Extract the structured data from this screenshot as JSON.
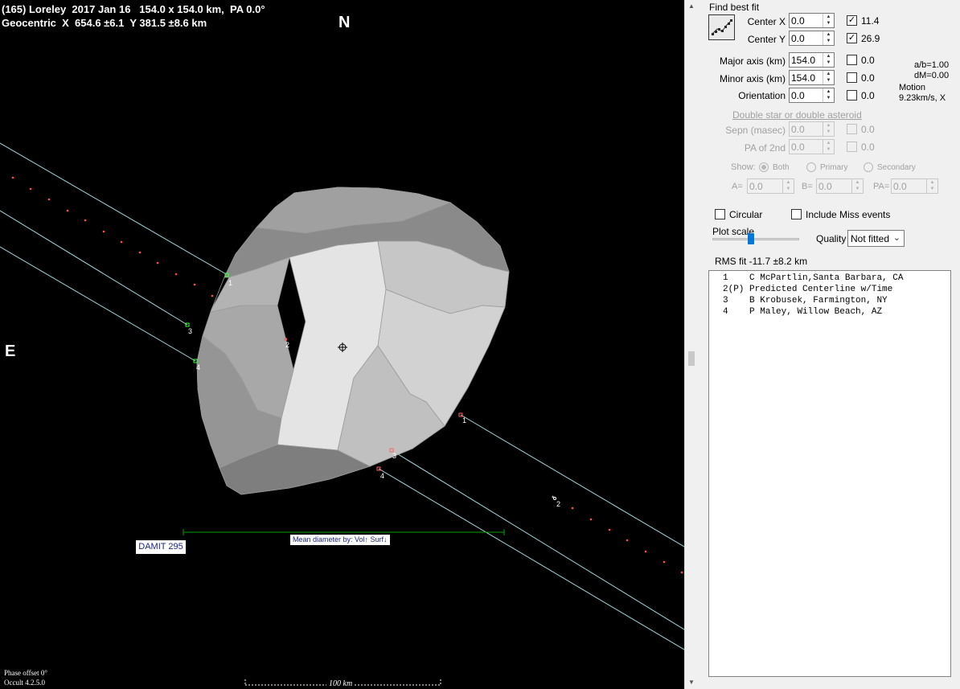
{
  "title": {
    "line1": "(165) Loreley  2017 Jan 16   154.0 x 154.0 km,  PA 0.0°",
    "line2": "Geocentric  X  654.6 ±6.1  Y 381.5 ±8.6 km"
  },
  "plot": {
    "north_label": "N",
    "east_label": "E",
    "damit_label": "DAMIT 295",
    "mean_diameter_label": "Mean diameter by:  Vol↑  Surf↓",
    "scale_bar_label": "100 km",
    "phase_offset": "Phase offset 0°",
    "version": "Occult 4.2.5.0",
    "chord_labels": [
      "1",
      "2",
      "3",
      "4",
      "1",
      "2",
      "3",
      "4",
      "2"
    ],
    "colors": {
      "background": "#000000",
      "chord": "#a8d8e0",
      "prediction_dots": "#ff5050",
      "scale_bar": "#00a000",
      "shape": "#b8b8b8"
    }
  },
  "panel": {
    "find_best_fit": "Find best fit",
    "center_x": {
      "label": "Center X",
      "value": "0.0",
      "checked": true,
      "fit": "11.4"
    },
    "center_y": {
      "label": "Center Y",
      "value": "0.0",
      "checked": true,
      "fit": "26.9"
    },
    "major_axis": {
      "label": "Major axis (km)",
      "value": "154.0",
      "checked": false,
      "fit": "0.0"
    },
    "minor_axis": {
      "label": "Minor axis (km)",
      "value": "154.0",
      "checked": false,
      "fit": "0.0"
    },
    "orientation": {
      "label": "Orientation",
      "value": "0.0",
      "checked": false,
      "fit": "0.0"
    },
    "ratio_info": "a/b=1.00",
    "dm_info": "dM=0.00",
    "motion_label": "Motion",
    "motion_value": "9.23km/s, X",
    "double_star_label": "Double star  or  double asteroid",
    "sepn": {
      "label": "Sepn (masec)",
      "value": "0.0",
      "fit": "0.0"
    },
    "pa_2nd": {
      "label": "PA of 2nd",
      "value": "0.0",
      "fit": "0.0"
    },
    "show_label": "Show:",
    "show_options": [
      "Both",
      "Primary",
      "Secondary"
    ],
    "a_label": "A=",
    "a_value": "0.0",
    "b_label": "B=",
    "b_value": "0.0",
    "pa_label": "PA=",
    "pa_value": "0.0",
    "circular_label": "Circular",
    "circular_checked": false,
    "miss_label": "Include Miss events",
    "miss_checked": false,
    "plot_scale_label": "Plot scale",
    "quality_label": "Quality",
    "quality_value": "Not fitted",
    "rms_fit": "RMS fit -11.7 ±8.2 km",
    "observers": [
      {
        "num": "1",
        "tag": "   ",
        "name": "C McPartlin,Santa Barbara, CA"
      },
      {
        "num": "2",
        "tag": "(P)",
        "name": "Predicted Centerline w/Time"
      },
      {
        "num": "3",
        "tag": "   ",
        "name": "B Krobusek, Farmington, NY"
      },
      {
        "num": "4",
        "tag": "   ",
        "name": "P Maley, Willow Beach, AZ"
      }
    ]
  }
}
